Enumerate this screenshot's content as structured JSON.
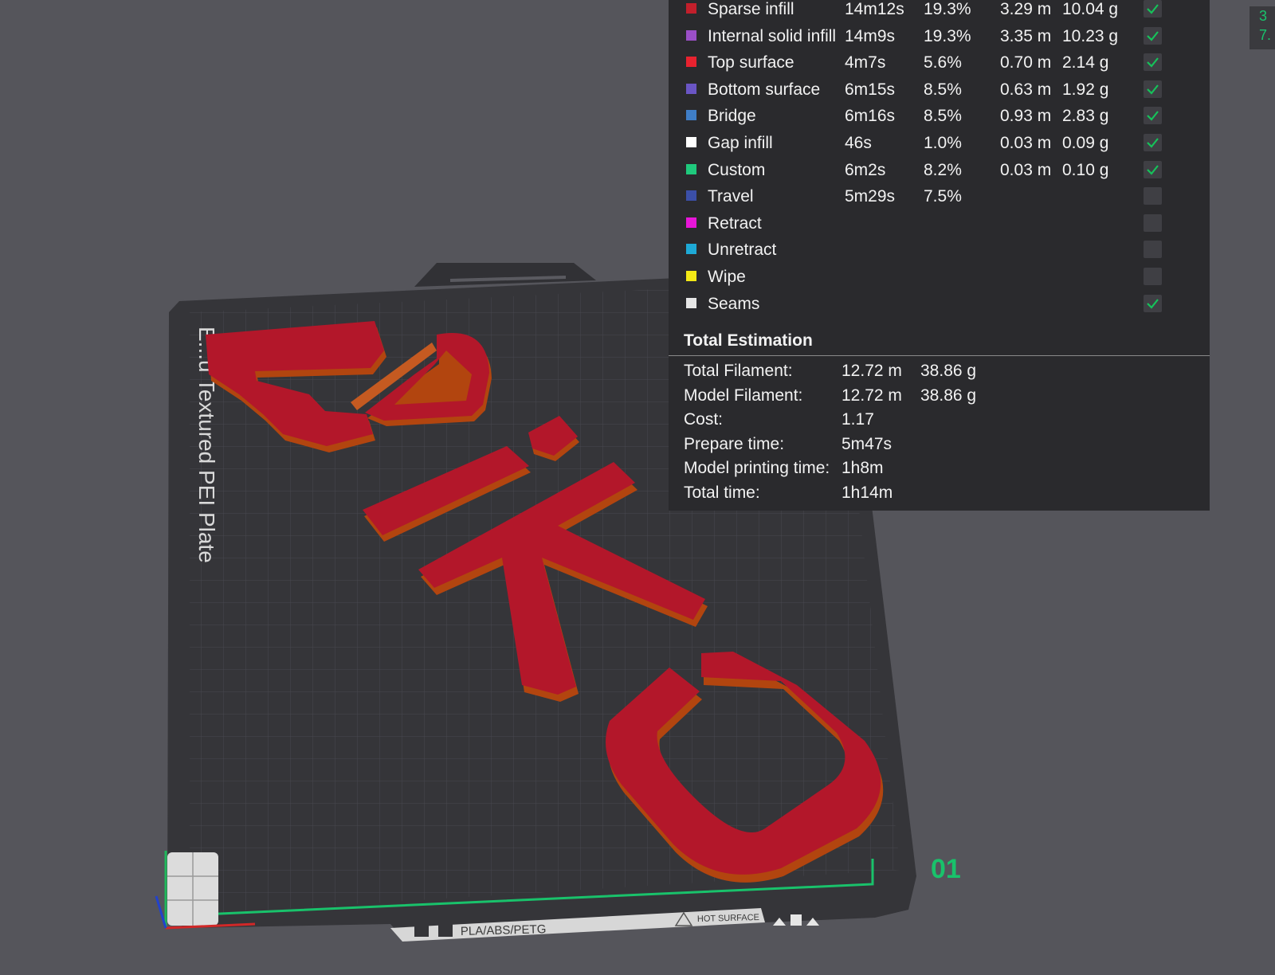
{
  "legend": {
    "rows": [
      {
        "name": "Sparse infill",
        "time": "14m12s",
        "percent": "19.3%",
        "length": "3.29 m",
        "weight": "10.04 g",
        "checked": true,
        "color": "#c21f2b"
      },
      {
        "name": "Internal solid infill",
        "time": "14m9s",
        "percent": "19.3%",
        "length": "3.35 m",
        "weight": "10.23 g",
        "checked": true,
        "color": "#9a4fc7"
      },
      {
        "name": "Top surface",
        "time": "4m7s",
        "percent": "5.6%",
        "length": "0.70 m",
        "weight": "2.14 g",
        "checked": true,
        "color": "#e8222f"
      },
      {
        "name": "Bottom surface",
        "time": "6m15s",
        "percent": "8.5%",
        "length": "0.63 m",
        "weight": "1.92 g",
        "checked": true,
        "color": "#6a55c4"
      },
      {
        "name": "Bridge",
        "time": "6m16s",
        "percent": "8.5%",
        "length": "0.93 m",
        "weight": "2.83 g",
        "checked": true,
        "color": "#3f7ec7"
      },
      {
        "name": "Gap infill",
        "time": "46s",
        "percent": "1.0%",
        "length": "0.03 m",
        "weight": "0.09 g",
        "checked": true,
        "color": "#ffffff"
      },
      {
        "name": "Custom",
        "time": "6m2s",
        "percent": "8.2%",
        "length": "0.03 m",
        "weight": "0.10 g",
        "checked": true,
        "color": "#1fc97c"
      },
      {
        "name": "Travel",
        "time": "5m29s",
        "percent": "7.5%",
        "length": "",
        "weight": "",
        "checked": false,
        "color": "#3b4fa8"
      },
      {
        "name": "Retract",
        "time": "",
        "percent": "",
        "length": "",
        "weight": "",
        "checked": false,
        "color": "#e716d8"
      },
      {
        "name": "Unretract",
        "time": "",
        "percent": "",
        "length": "",
        "weight": "",
        "checked": false,
        "color": "#1ea9d6"
      },
      {
        "name": "Wipe",
        "time": "",
        "percent": "",
        "length": "",
        "weight": "",
        "checked": false,
        "color": "#f4e916"
      },
      {
        "name": "Seams",
        "time": "",
        "percent": "",
        "length": "",
        "weight": "",
        "checked": true,
        "color": "#e6e6e6"
      }
    ]
  },
  "total": {
    "title": "Total Estimation",
    "rows": [
      {
        "label": "Total Filament:",
        "v1": "12.72 m",
        "v2": "38.86 g"
      },
      {
        "label": "Model Filament:",
        "v1": "12.72 m",
        "v2": "38.86 g"
      },
      {
        "label": "Cost:",
        "v1": "1.17",
        "v2": ""
      },
      {
        "label": "Prepare time:",
        "v1": "5m47s",
        "v2": ""
      },
      {
        "label": "Model printing time:",
        "v1": "1h8m",
        "v2": ""
      },
      {
        "label": "Total time:",
        "v1": "1h14m",
        "v2": ""
      }
    ]
  },
  "plate": {
    "name": "E...u Textured PEI Plate",
    "number": "01",
    "strip_material": "PLA/ABS/PETG",
    "strip_badge": "HOT SURFACE"
  },
  "corner_readout": {
    "line1": "3",
    "line2": "7."
  },
  "colors": {
    "model": "#b3172a",
    "model_edge": "#b2450f",
    "bed": "#353539",
    "grid": "#4a4a50",
    "check": "#16c25a",
    "axis_green": "#19c26b"
  }
}
